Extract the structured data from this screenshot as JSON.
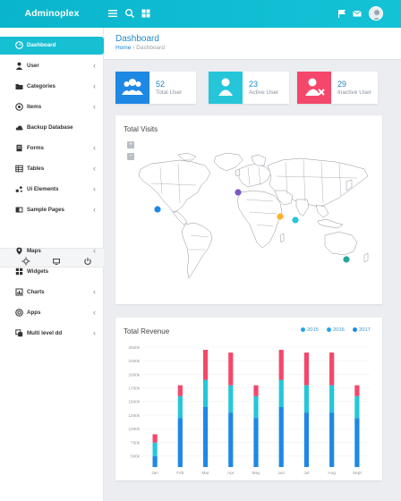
{
  "app": {
    "brand": "Adminoplex"
  },
  "sidebar": {
    "items": [
      {
        "label": "Dashboard",
        "icon": "dashboard-icon",
        "active": true,
        "chevron": false
      },
      {
        "label": "User",
        "icon": "user-icon",
        "active": false,
        "chevron": true
      },
      {
        "label": "Categories",
        "icon": "folder-icon",
        "active": false,
        "chevron": true
      },
      {
        "label": "Items",
        "icon": "items-icon",
        "active": false,
        "chevron": true
      },
      {
        "label": "Backup Database",
        "icon": "database-icon",
        "active": false,
        "chevron": false
      },
      {
        "label": "Forms",
        "icon": "form-icon",
        "active": false,
        "chevron": true
      },
      {
        "label": "Tables",
        "icon": "table-icon",
        "active": false,
        "chevron": true
      },
      {
        "label": "Ui Elements",
        "icon": "ui-elements-icon",
        "active": false,
        "chevron": true
      },
      {
        "label": "Sample Pages",
        "icon": "pages-icon",
        "active": false,
        "chevron": true
      },
      {
        "label": "Maps",
        "icon": "map-marker-icon",
        "active": false,
        "chevron": true
      },
      {
        "label": "Widgets",
        "icon": "widgets-icon",
        "active": false,
        "chevron": false
      },
      {
        "label": "Charts",
        "icon": "chart-icon",
        "active": false,
        "chevron": true
      },
      {
        "label": "Apps",
        "icon": "apps-icon",
        "active": false,
        "chevron": true
      },
      {
        "label": "Multi level dd",
        "icon": "multi-level-icon",
        "active": false,
        "chevron": true
      }
    ],
    "tools": [
      "settings-icon",
      "monitor-icon",
      "power-icon"
    ],
    "chevron": "‹"
  },
  "header": {
    "title": "Dashboard",
    "breadcrumb": {
      "home": "Home",
      "separator": "›",
      "current": "Dashboard"
    }
  },
  "stats": [
    {
      "value": "52",
      "label": "Total User",
      "color": "#1e88e5",
      "icon": "users-group-icon"
    },
    {
      "value": "23",
      "label": "Active User",
      "color": "#26c6da",
      "icon": "user-active-icon"
    },
    {
      "value": "29",
      "label": "Inactive User",
      "color": "#f4476b",
      "icon": "user-remove-icon"
    }
  ],
  "visits": {
    "title": "Total Visits",
    "zoom_in": "+",
    "zoom_out": "−",
    "marker_colors": [
      "#1e88e5",
      "#7e57c2",
      "#ffb22b",
      "#26c6da",
      "#26a69a"
    ]
  },
  "revenue": {
    "title": "Total Revenue"
  },
  "chart_data": {
    "type": "bar",
    "stacked": true,
    "title": "Total Revenue",
    "categories": [
      "Jan",
      "Feb",
      "Mar",
      "Apr",
      "May",
      "Jun",
      "Jul",
      "Aug",
      "Sept"
    ],
    "series": [
      {
        "name": "2017",
        "color": "#1e88e5",
        "values": [
          500,
          1200,
          1400,
          1300,
          1200,
          1400,
          1300,
          1300,
          1200
        ]
      },
      {
        "name": "2016",
        "color": "#26c6da",
        "values": [
          250,
          400,
          500,
          500,
          400,
          500,
          500,
          500,
          400
        ]
      },
      {
        "name": "2015",
        "color": "#f4476b",
        "values": [
          150,
          200,
          550,
          600,
          200,
          550,
          600,
          600,
          200
        ]
      }
    ],
    "legend_order": [
      "2015",
      "2016",
      "2017"
    ],
    "yticks": [
      "500k",
      "750k",
      "1000k",
      "1250k",
      "1500k",
      "1750k",
      "2000k",
      "2250k",
      "2500k"
    ],
    "ylim": [
      300,
      2500
    ],
    "grid": true,
    "legend": "top-right"
  }
}
